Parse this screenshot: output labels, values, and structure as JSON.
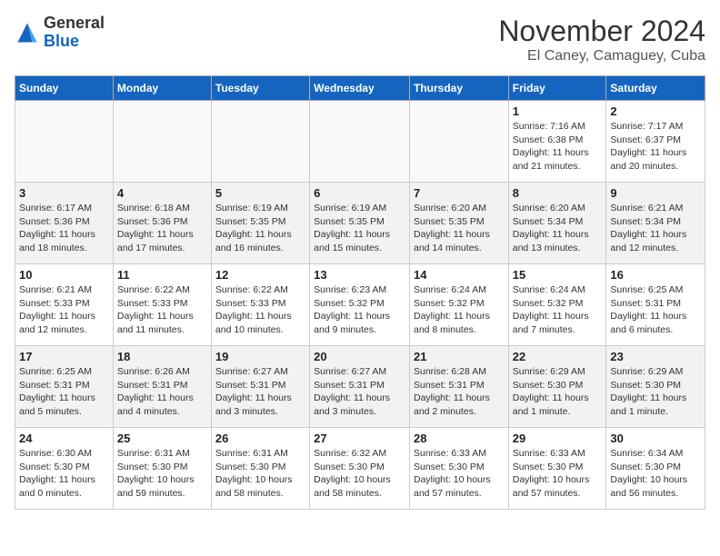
{
  "header": {
    "logo_general": "General",
    "logo_blue": "Blue",
    "month_title": "November 2024",
    "location": "El Caney, Camaguey, Cuba"
  },
  "weekdays": [
    "Sunday",
    "Monday",
    "Tuesday",
    "Wednesday",
    "Thursday",
    "Friday",
    "Saturday"
  ],
  "weeks": [
    [
      {
        "day": "",
        "info": ""
      },
      {
        "day": "",
        "info": ""
      },
      {
        "day": "",
        "info": ""
      },
      {
        "day": "",
        "info": ""
      },
      {
        "day": "",
        "info": ""
      },
      {
        "day": "1",
        "info": "Sunrise: 7:16 AM\nSunset: 6:38 PM\nDaylight: 11 hours and 21 minutes."
      },
      {
        "day": "2",
        "info": "Sunrise: 7:17 AM\nSunset: 6:37 PM\nDaylight: 11 hours and 20 minutes."
      }
    ],
    [
      {
        "day": "3",
        "info": "Sunrise: 6:17 AM\nSunset: 5:36 PM\nDaylight: 11 hours and 18 minutes."
      },
      {
        "day": "4",
        "info": "Sunrise: 6:18 AM\nSunset: 5:36 PM\nDaylight: 11 hours and 17 minutes."
      },
      {
        "day": "5",
        "info": "Sunrise: 6:19 AM\nSunset: 5:35 PM\nDaylight: 11 hours and 16 minutes."
      },
      {
        "day": "6",
        "info": "Sunrise: 6:19 AM\nSunset: 5:35 PM\nDaylight: 11 hours and 15 minutes."
      },
      {
        "day": "7",
        "info": "Sunrise: 6:20 AM\nSunset: 5:35 PM\nDaylight: 11 hours and 14 minutes."
      },
      {
        "day": "8",
        "info": "Sunrise: 6:20 AM\nSunset: 5:34 PM\nDaylight: 11 hours and 13 minutes."
      },
      {
        "day": "9",
        "info": "Sunrise: 6:21 AM\nSunset: 5:34 PM\nDaylight: 11 hours and 12 minutes."
      }
    ],
    [
      {
        "day": "10",
        "info": "Sunrise: 6:21 AM\nSunset: 5:33 PM\nDaylight: 11 hours and 12 minutes."
      },
      {
        "day": "11",
        "info": "Sunrise: 6:22 AM\nSunset: 5:33 PM\nDaylight: 11 hours and 11 minutes."
      },
      {
        "day": "12",
        "info": "Sunrise: 6:22 AM\nSunset: 5:33 PM\nDaylight: 11 hours and 10 minutes."
      },
      {
        "day": "13",
        "info": "Sunrise: 6:23 AM\nSunset: 5:32 PM\nDaylight: 11 hours and 9 minutes."
      },
      {
        "day": "14",
        "info": "Sunrise: 6:24 AM\nSunset: 5:32 PM\nDaylight: 11 hours and 8 minutes."
      },
      {
        "day": "15",
        "info": "Sunrise: 6:24 AM\nSunset: 5:32 PM\nDaylight: 11 hours and 7 minutes."
      },
      {
        "day": "16",
        "info": "Sunrise: 6:25 AM\nSunset: 5:31 PM\nDaylight: 11 hours and 6 minutes."
      }
    ],
    [
      {
        "day": "17",
        "info": "Sunrise: 6:25 AM\nSunset: 5:31 PM\nDaylight: 11 hours and 5 minutes."
      },
      {
        "day": "18",
        "info": "Sunrise: 6:26 AM\nSunset: 5:31 PM\nDaylight: 11 hours and 4 minutes."
      },
      {
        "day": "19",
        "info": "Sunrise: 6:27 AM\nSunset: 5:31 PM\nDaylight: 11 hours and 3 minutes."
      },
      {
        "day": "20",
        "info": "Sunrise: 6:27 AM\nSunset: 5:31 PM\nDaylight: 11 hours and 3 minutes."
      },
      {
        "day": "21",
        "info": "Sunrise: 6:28 AM\nSunset: 5:31 PM\nDaylight: 11 hours and 2 minutes."
      },
      {
        "day": "22",
        "info": "Sunrise: 6:29 AM\nSunset: 5:30 PM\nDaylight: 11 hours and 1 minute."
      },
      {
        "day": "23",
        "info": "Sunrise: 6:29 AM\nSunset: 5:30 PM\nDaylight: 11 hours and 1 minute."
      }
    ],
    [
      {
        "day": "24",
        "info": "Sunrise: 6:30 AM\nSunset: 5:30 PM\nDaylight: 11 hours and 0 minutes."
      },
      {
        "day": "25",
        "info": "Sunrise: 6:31 AM\nSunset: 5:30 PM\nDaylight: 10 hours and 59 minutes."
      },
      {
        "day": "26",
        "info": "Sunrise: 6:31 AM\nSunset: 5:30 PM\nDaylight: 10 hours and 58 minutes."
      },
      {
        "day": "27",
        "info": "Sunrise: 6:32 AM\nSunset: 5:30 PM\nDaylight: 10 hours and 58 minutes."
      },
      {
        "day": "28",
        "info": "Sunrise: 6:33 AM\nSunset: 5:30 PM\nDaylight: 10 hours and 57 minutes."
      },
      {
        "day": "29",
        "info": "Sunrise: 6:33 AM\nSunset: 5:30 PM\nDaylight: 10 hours and 57 minutes."
      },
      {
        "day": "30",
        "info": "Sunrise: 6:34 AM\nSunset: 5:30 PM\nDaylight: 10 hours and 56 minutes."
      }
    ]
  ]
}
